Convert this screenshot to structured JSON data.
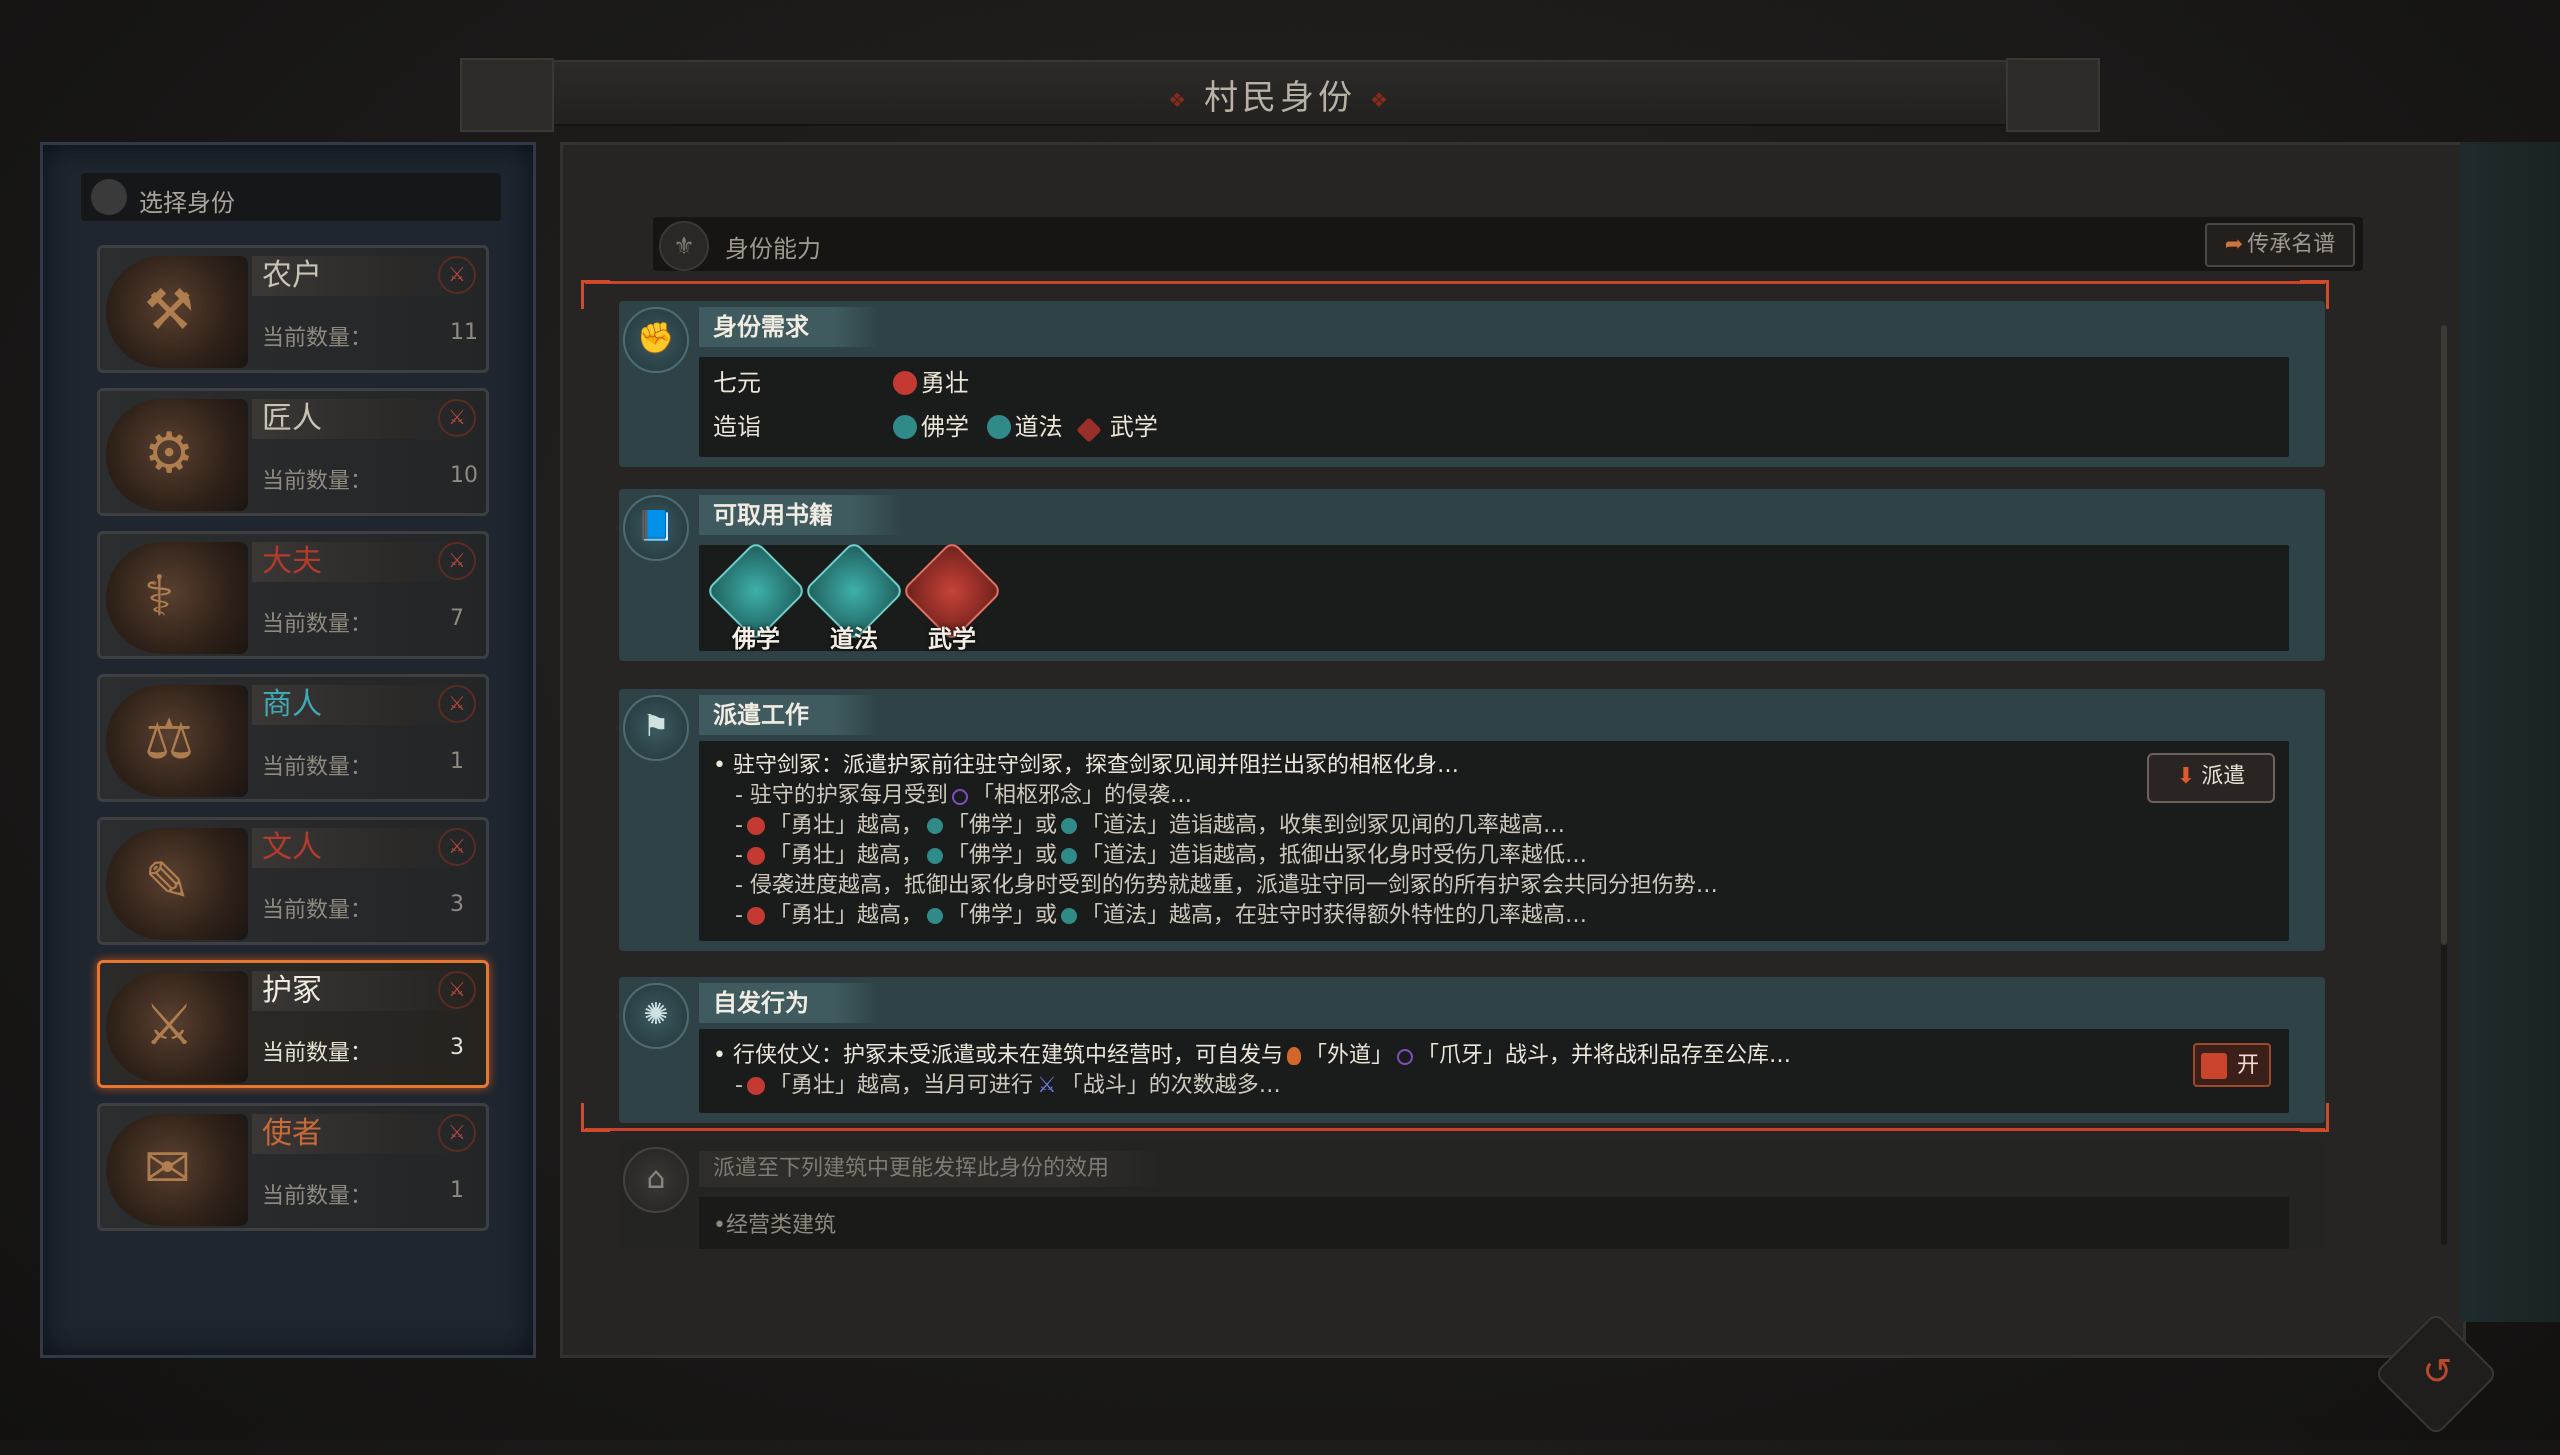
{
  "title": "村民身份",
  "left_panel": {
    "header": "选择身份",
    "count_label": "当前数量：",
    "identities": [
      {
        "name": "农户",
        "count": "11",
        "glyph": "⚒",
        "name_color": "default",
        "selected": false
      },
      {
        "name": "匠人",
        "count": "10",
        "glyph": "⚙",
        "name_color": "default",
        "selected": false
      },
      {
        "name": "大夫",
        "count": "7",
        "glyph": "⚕",
        "name_color": "red",
        "selected": false
      },
      {
        "name": "商人",
        "count": "1",
        "glyph": "⚖",
        "name_color": "teal",
        "selected": false
      },
      {
        "name": "文人",
        "count": "3",
        "glyph": "✎",
        "name_color": "red",
        "selected": false
      },
      {
        "name": "护冢",
        "count": "3",
        "glyph": "⚔",
        "name_color": "default",
        "selected": true
      },
      {
        "name": "使者",
        "count": "1",
        "glyph": "✉",
        "name_color": "orange",
        "selected": false
      }
    ]
  },
  "ability": {
    "header": "身份能力",
    "lineage_button": "传承名谱",
    "requirements": {
      "title": "身份需求",
      "rows": [
        {
          "key": "七元",
          "chips": [
            {
              "label": "勇壮",
              "color": "red"
            }
          ]
        },
        {
          "key": "造诣",
          "chips": [
            {
              "label": "佛学",
              "color": "teal"
            },
            {
              "label": "道法",
              "color": "teal"
            },
            {
              "label": "武学",
              "color": "redd"
            }
          ]
        }
      ]
    },
    "books": {
      "title": "可取用书籍",
      "items": [
        {
          "label": "佛学",
          "color": "teal"
        },
        {
          "label": "道法",
          "color": "teal"
        },
        {
          "label": "武学",
          "color": "red"
        }
      ]
    },
    "dispatch": {
      "title": "派遣工作",
      "button": "派遣",
      "main": "• 驻守剑冢：派遣护冢前往驻守剑冢，探查剑冢见闻并阻拦出冢的相枢化身…",
      "l1": "- 驻守的护冢每月受到",
      "l1b": "「相枢邪念」的侵袭…",
      "l2a": "-",
      "l2b": "「勇壮」越高，",
      "l2c": "「佛学」或",
      "l2d": "「道法」造诣越高，收集到剑冢见闻的几率越高…",
      "l3b": "「勇壮」越高，",
      "l3c": "「佛学」或",
      "l3d": "「道法」造诣越高，抵御出冢化身时受伤几率越低…",
      "l4": "- 侵袭进度越高，抵御出冢化身时受到的伤势就越重，派遣驻守同一剑冢的所有护冢会共同分担伤势…",
      "l5b": "「勇壮」越高，",
      "l5c": "「佛学」或",
      "l5d": "「道法」越高，在驻守时获得额外特性的几率越高…"
    },
    "spontaneous": {
      "title": "自发行为",
      "toggle": "开",
      "main_a": "• 行侠仗义：护冢未受派遣或未在建筑中经营时，可自发与",
      "main_b": "「外道」",
      "main_c": "「爪牙」战斗，并将战利品存至公库…",
      "sub_a": "-",
      "sub_b": "「勇壮」越高，当月可进行",
      "sub_c": "「战斗」的次数越多…"
    },
    "hint": {
      "title": "派遣至下列建筑中更能发挥此身份的效用",
      "item": "•经营类建筑"
    }
  },
  "colors": {
    "accent": "#c8442a",
    "teal": "#2f8a88",
    "selected_border": "#e8762f"
  },
  "icons": [
    "fist-icon",
    "book-icon",
    "dispatch-icon",
    "spontaneous-icon",
    "building-icon",
    "back-icon"
  ]
}
